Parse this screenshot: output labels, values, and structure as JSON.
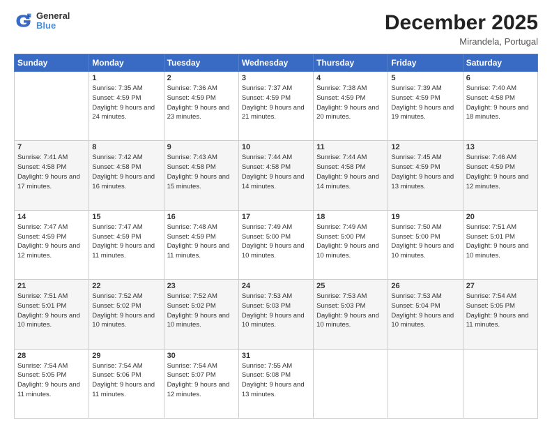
{
  "header": {
    "logo_line1": "General",
    "logo_line2": "Blue",
    "month_title": "December 2025",
    "location": "Mirandela, Portugal"
  },
  "days_of_week": [
    "Sunday",
    "Monday",
    "Tuesday",
    "Wednesday",
    "Thursday",
    "Friday",
    "Saturday"
  ],
  "weeks": [
    [
      {
        "day": "",
        "sunrise": "",
        "sunset": "",
        "daylight": ""
      },
      {
        "day": "1",
        "sunrise": "Sunrise: 7:35 AM",
        "sunset": "Sunset: 4:59 PM",
        "daylight": "Daylight: 9 hours and 24 minutes."
      },
      {
        "day": "2",
        "sunrise": "Sunrise: 7:36 AM",
        "sunset": "Sunset: 4:59 PM",
        "daylight": "Daylight: 9 hours and 23 minutes."
      },
      {
        "day": "3",
        "sunrise": "Sunrise: 7:37 AM",
        "sunset": "Sunset: 4:59 PM",
        "daylight": "Daylight: 9 hours and 21 minutes."
      },
      {
        "day": "4",
        "sunrise": "Sunrise: 7:38 AM",
        "sunset": "Sunset: 4:59 PM",
        "daylight": "Daylight: 9 hours and 20 minutes."
      },
      {
        "day": "5",
        "sunrise": "Sunrise: 7:39 AM",
        "sunset": "Sunset: 4:59 PM",
        "daylight": "Daylight: 9 hours and 19 minutes."
      },
      {
        "day": "6",
        "sunrise": "Sunrise: 7:40 AM",
        "sunset": "Sunset: 4:58 PM",
        "daylight": "Daylight: 9 hours and 18 minutes."
      }
    ],
    [
      {
        "day": "7",
        "sunrise": "Sunrise: 7:41 AM",
        "sunset": "Sunset: 4:58 PM",
        "daylight": "Daylight: 9 hours and 17 minutes."
      },
      {
        "day": "8",
        "sunrise": "Sunrise: 7:42 AM",
        "sunset": "Sunset: 4:58 PM",
        "daylight": "Daylight: 9 hours and 16 minutes."
      },
      {
        "day": "9",
        "sunrise": "Sunrise: 7:43 AM",
        "sunset": "Sunset: 4:58 PM",
        "daylight": "Daylight: 9 hours and 15 minutes."
      },
      {
        "day": "10",
        "sunrise": "Sunrise: 7:44 AM",
        "sunset": "Sunset: 4:58 PM",
        "daylight": "Daylight: 9 hours and 14 minutes."
      },
      {
        "day": "11",
        "sunrise": "Sunrise: 7:44 AM",
        "sunset": "Sunset: 4:58 PM",
        "daylight": "Daylight: 9 hours and 14 minutes."
      },
      {
        "day": "12",
        "sunrise": "Sunrise: 7:45 AM",
        "sunset": "Sunset: 4:59 PM",
        "daylight": "Daylight: 9 hours and 13 minutes."
      },
      {
        "day": "13",
        "sunrise": "Sunrise: 7:46 AM",
        "sunset": "Sunset: 4:59 PM",
        "daylight": "Daylight: 9 hours and 12 minutes."
      }
    ],
    [
      {
        "day": "14",
        "sunrise": "Sunrise: 7:47 AM",
        "sunset": "Sunset: 4:59 PM",
        "daylight": "Daylight: 9 hours and 12 minutes."
      },
      {
        "day": "15",
        "sunrise": "Sunrise: 7:47 AM",
        "sunset": "Sunset: 4:59 PM",
        "daylight": "Daylight: 9 hours and 11 minutes."
      },
      {
        "day": "16",
        "sunrise": "Sunrise: 7:48 AM",
        "sunset": "Sunset: 4:59 PM",
        "daylight": "Daylight: 9 hours and 11 minutes."
      },
      {
        "day": "17",
        "sunrise": "Sunrise: 7:49 AM",
        "sunset": "Sunset: 5:00 PM",
        "daylight": "Daylight: 9 hours and 10 minutes."
      },
      {
        "day": "18",
        "sunrise": "Sunrise: 7:49 AM",
        "sunset": "Sunset: 5:00 PM",
        "daylight": "Daylight: 9 hours and 10 minutes."
      },
      {
        "day": "19",
        "sunrise": "Sunrise: 7:50 AM",
        "sunset": "Sunset: 5:00 PM",
        "daylight": "Daylight: 9 hours and 10 minutes."
      },
      {
        "day": "20",
        "sunrise": "Sunrise: 7:51 AM",
        "sunset": "Sunset: 5:01 PM",
        "daylight": "Daylight: 9 hours and 10 minutes."
      }
    ],
    [
      {
        "day": "21",
        "sunrise": "Sunrise: 7:51 AM",
        "sunset": "Sunset: 5:01 PM",
        "daylight": "Daylight: 9 hours and 10 minutes."
      },
      {
        "day": "22",
        "sunrise": "Sunrise: 7:52 AM",
        "sunset": "Sunset: 5:02 PM",
        "daylight": "Daylight: 9 hours and 10 minutes."
      },
      {
        "day": "23",
        "sunrise": "Sunrise: 7:52 AM",
        "sunset": "Sunset: 5:02 PM",
        "daylight": "Daylight: 9 hours and 10 minutes."
      },
      {
        "day": "24",
        "sunrise": "Sunrise: 7:53 AM",
        "sunset": "Sunset: 5:03 PM",
        "daylight": "Daylight: 9 hours and 10 minutes."
      },
      {
        "day": "25",
        "sunrise": "Sunrise: 7:53 AM",
        "sunset": "Sunset: 5:03 PM",
        "daylight": "Daylight: 9 hours and 10 minutes."
      },
      {
        "day": "26",
        "sunrise": "Sunrise: 7:53 AM",
        "sunset": "Sunset: 5:04 PM",
        "daylight": "Daylight: 9 hours and 10 minutes."
      },
      {
        "day": "27",
        "sunrise": "Sunrise: 7:54 AM",
        "sunset": "Sunset: 5:05 PM",
        "daylight": "Daylight: 9 hours and 11 minutes."
      }
    ],
    [
      {
        "day": "28",
        "sunrise": "Sunrise: 7:54 AM",
        "sunset": "Sunset: 5:05 PM",
        "daylight": "Daylight: 9 hours and 11 minutes."
      },
      {
        "day": "29",
        "sunrise": "Sunrise: 7:54 AM",
        "sunset": "Sunset: 5:06 PM",
        "daylight": "Daylight: 9 hours and 11 minutes."
      },
      {
        "day": "30",
        "sunrise": "Sunrise: 7:54 AM",
        "sunset": "Sunset: 5:07 PM",
        "daylight": "Daylight: 9 hours and 12 minutes."
      },
      {
        "day": "31",
        "sunrise": "Sunrise: 7:55 AM",
        "sunset": "Sunset: 5:08 PM",
        "daylight": "Daylight: 9 hours and 13 minutes."
      },
      {
        "day": "",
        "sunrise": "",
        "sunset": "",
        "daylight": ""
      },
      {
        "day": "",
        "sunrise": "",
        "sunset": "",
        "daylight": ""
      },
      {
        "day": "",
        "sunrise": "",
        "sunset": "",
        "daylight": ""
      }
    ]
  ]
}
